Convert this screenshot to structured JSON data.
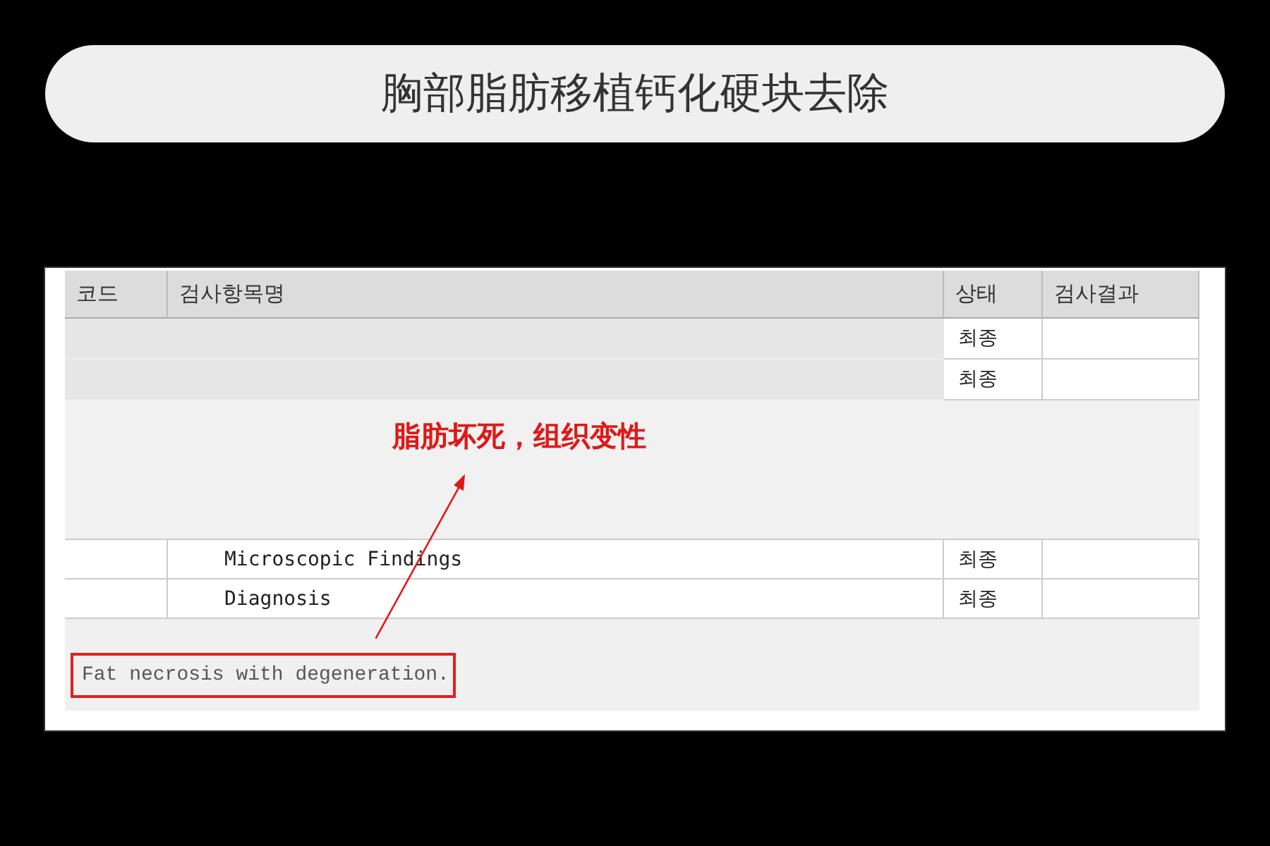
{
  "title": "胸部脂肪移植钙化硬块去除",
  "table": {
    "columns": [
      {
        "label": "코드"
      },
      {
        "label": "검사항목명"
      },
      {
        "label": "상태"
      },
      {
        "label": "검사결과"
      }
    ],
    "rows": [
      {
        "kind": "redacted",
        "status": "최종"
      },
      {
        "kind": "redacted",
        "status": "최종"
      },
      {
        "kind": "blank"
      },
      {
        "kind": "item",
        "name": "Microscopic Findings",
        "status": "최종"
      },
      {
        "kind": "item",
        "name": "Diagnosis",
        "status": "최종"
      }
    ]
  },
  "result": {
    "text": "Fat necrosis with degeneration.",
    "highlighted": true
  },
  "annotation": {
    "text": "脂肪坏死，组织变性"
  }
}
